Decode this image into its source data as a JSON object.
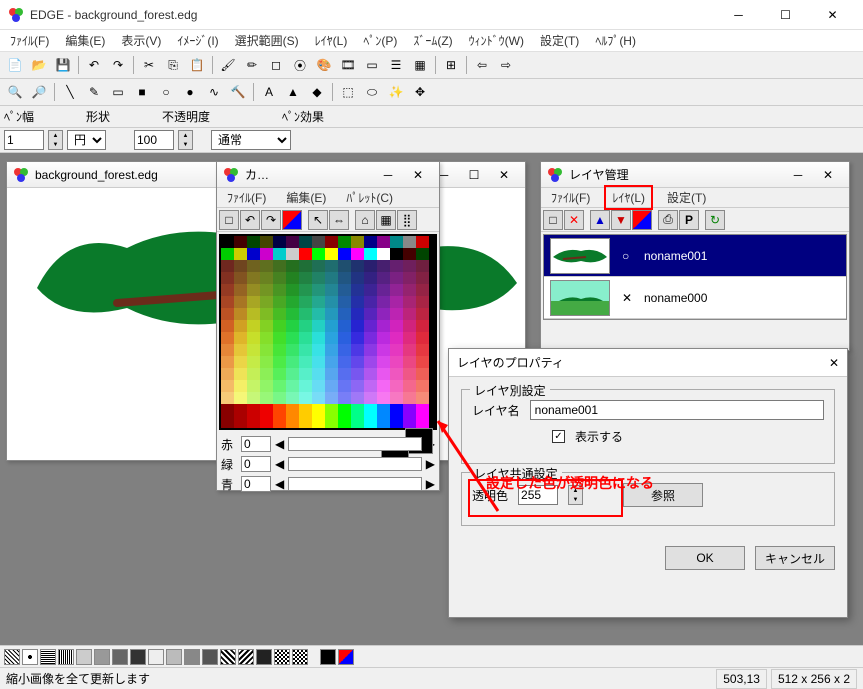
{
  "app": {
    "title": "EDGE - background_forest.edg"
  },
  "menubar": [
    "ﾌｧｲﾙ(F)",
    "編集(E)",
    "表示(V)",
    "ｲﾒｰｼﾞ(I)",
    "選択範囲(S)",
    "ﾚｲﾔ(L)",
    "ﾍﾟﾝ(P)",
    "ｽﾞｰﾑ(Z)",
    "ｳｨﾝﾄﾞｳ(W)",
    "設定(T)",
    "ﾍﾙﾌﾟ(H)"
  ],
  "params": {
    "pen_width_label": "ﾍﾟﾝ幅",
    "pen_width_value": "1",
    "shape_label": "形状",
    "shape_value": "円",
    "opacity_label": "不透明度",
    "opacity_value": "100",
    "effect_label": "ﾍﾟﾝ効果",
    "effect_value": "通常"
  },
  "canvas_window": {
    "title": "background_forest.edg"
  },
  "palette_window": {
    "title": "カ…",
    "menu": [
      "ﾌｧｲﾙ(F)",
      "編集(E)",
      "ﾊﾟﾚｯﾄ(C)"
    ],
    "rgb": {
      "r_label": "赤",
      "g_label": "緑",
      "b_label": "青",
      "r": "0",
      "g": "0",
      "b": "0"
    }
  },
  "layer_window": {
    "title": "レイヤ管理",
    "menu": [
      "ﾌｧｲﾙ(F)",
      "ﾚｲﾔ(L)",
      "設定(T)"
    ],
    "layers": [
      {
        "name": "noname001",
        "selected": true
      },
      {
        "name": "noname000",
        "selected": false
      }
    ]
  },
  "dialog": {
    "title": "レイヤのプロパティ",
    "group1_legend": "レイヤ別設定",
    "layer_name_label": "レイヤ名",
    "layer_name_value": "noname001",
    "show_label": "表示する",
    "group2_legend": "レイヤ共通設定",
    "trans_label": "透明色",
    "trans_value": "255",
    "browse_label": "参照",
    "ok": "OK",
    "cancel": "キャンセル"
  },
  "annotation": "設定した色が透明色になる",
  "status": {
    "msg": "縮小画像を全て更新します",
    "coord": "503,13",
    "dims": "512 x 256 x 2"
  }
}
